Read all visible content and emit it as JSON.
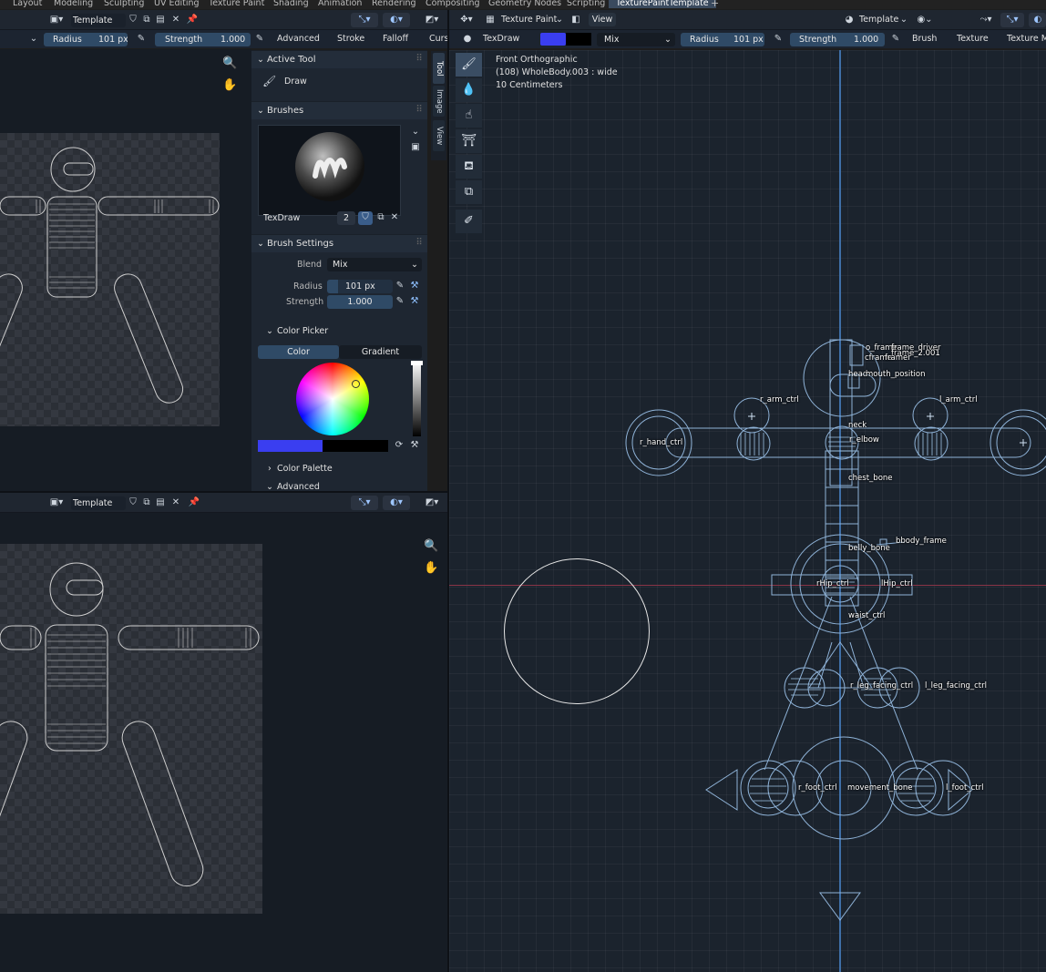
{
  "workspace_tabs": [
    "Layout",
    "Modeling",
    "Sculpting",
    "UV Editing",
    "Texture Paint",
    "Shading",
    "Animation",
    "Rendering",
    "Compositing",
    "Geometry Nodes",
    "Scripting",
    "TexturePaintTemplate"
  ],
  "add_tab_label": "+",
  "image_editor_top": {
    "image_name": "Template",
    "tool_settings": {
      "radius_label": "Radius",
      "radius_value": "101 px",
      "strength_label": "Strength",
      "strength_value": "1.000",
      "menus": [
        "Advanced",
        "Stroke",
        "Falloff",
        "Curs"
      ]
    }
  },
  "sidebar": {
    "tabs": [
      "Tool",
      "Image",
      "View"
    ],
    "active_tool": {
      "title": "Active Tool",
      "tool_name": "Draw"
    },
    "brushes": {
      "title": "Brushes",
      "brush_name": "TexDraw",
      "user_count": "2"
    },
    "brush_settings": {
      "title": "Brush Settings",
      "blend_label": "Blend",
      "blend_value": "Mix",
      "radius_label": "Radius",
      "radius_value": "101 px",
      "strength_label": "Strength",
      "strength_value": "1.000"
    },
    "color_picker": {
      "title": "Color Picker",
      "tab_color": "Color",
      "tab_gradient": "Gradient",
      "swatch_color": "#3a3ef0"
    },
    "color_palette": "Color Palette",
    "advanced": "Advanced"
  },
  "image_editor_bottom": {
    "image_name": "Template"
  },
  "viewport": {
    "mode": "Texture Paint",
    "view_menu": "View",
    "view_layer": "Template",
    "brush_name": "TexDraw",
    "color_swatch": "#3a3ef0",
    "blend_value": "Mix",
    "radius_label": "Radius",
    "radius_value": "101 px",
    "strength_label": "Strength",
    "strength_value": "1.000",
    "menus": [
      "Brush",
      "Texture",
      "Texture M"
    ],
    "overlay_line1": "Front Orthographic",
    "overlay_line2": "(108) WholeBody.003 : wide",
    "overlay_line3": "10 Centimeters"
  },
  "bones": {
    "o_frame": "o_frame",
    "frame_driver": "frame_driver",
    "frame_2001": "frame_2.001",
    "c_frame": "cframe",
    "c_framer": "framer",
    "head": "head",
    "mouth_position": "mouth_position",
    "r_arm_ctrl": "r_arm_ctrl",
    "l_arm_ctrl": "l_arm_ctrl",
    "neck": "neck",
    "r_hand_ctrl": "r_hand_ctrl",
    "r_elbow": "r_elbow",
    "chest_bone": "chest_bone",
    "body_frame": "bbody_frame",
    "belly_bone": "belly_bone",
    "r_hip_ctrl": "rHip_ctrl",
    "l_hip_ctrl": "lHip_ctrl",
    "waist_ctrl": "waist_ctrl",
    "r_leg_facing_ctrl": "r_leg_facing_ctrl",
    "l_leg_facing_ctrl": "l_leg_facing_ctrl",
    "r_foot_ctrl": "r_foot_ctrl",
    "movement_bone": "movement_bone",
    "l_foot_ctrl": "l_foot_ctrl"
  }
}
